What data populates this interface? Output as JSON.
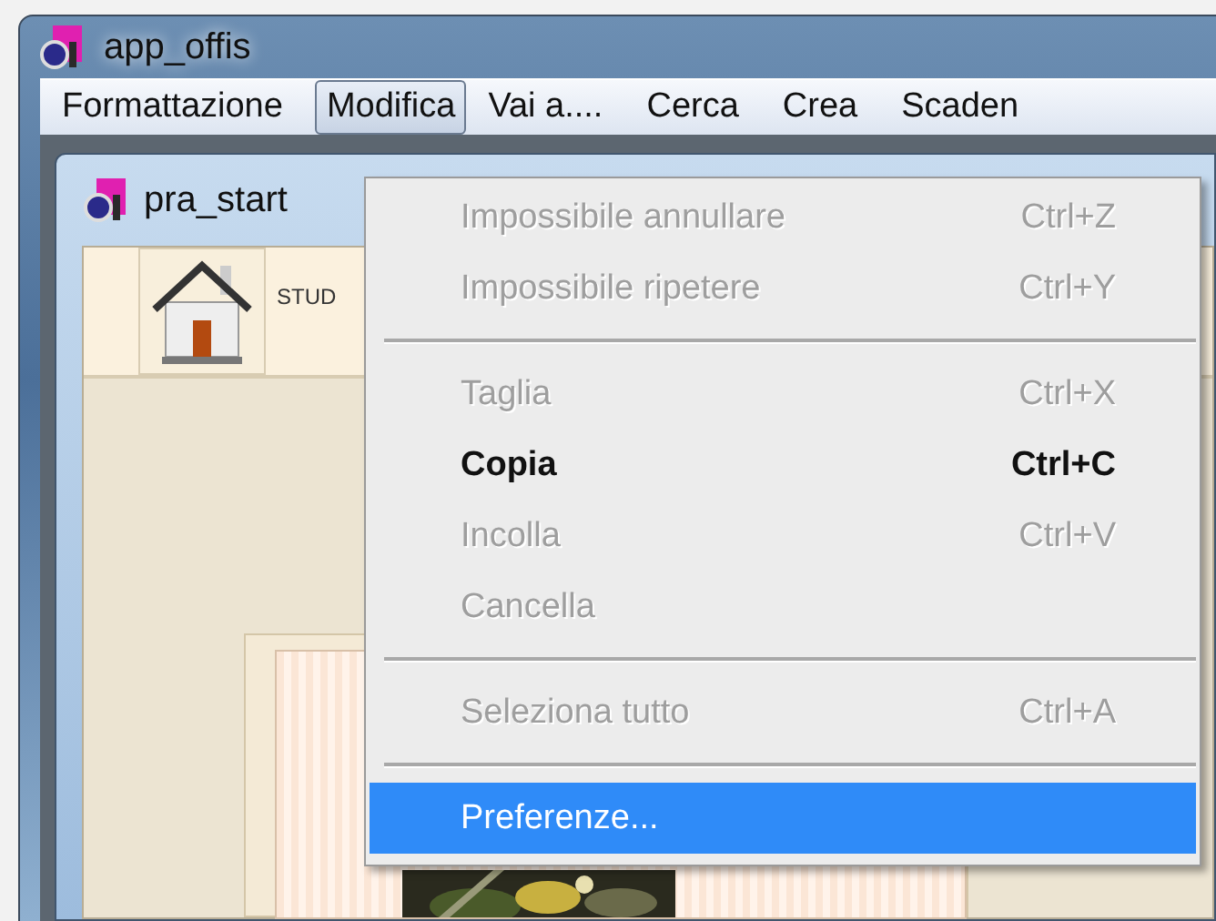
{
  "window": {
    "title": "app_offis"
  },
  "menubar": [
    {
      "label": "Formattazione",
      "selected": false
    },
    {
      "label": "Modifica",
      "selected": true
    },
    {
      "label": "Vai a....",
      "selected": false
    },
    {
      "label": "Cerca",
      "selected": false
    },
    {
      "label": "Crea",
      "selected": false
    },
    {
      "label": "Scaden",
      "selected": false
    }
  ],
  "child_window": {
    "title": "pra_start",
    "toolbar_label": "STUD"
  },
  "menu": [
    {
      "kind": "item",
      "label": "Impossibile annullare",
      "shortcut": "Ctrl+Z",
      "disabled": true,
      "bold": false,
      "selected": false
    },
    {
      "kind": "item",
      "label": "Impossibile ripetere",
      "shortcut": "Ctrl+Y",
      "disabled": true,
      "bold": false,
      "selected": false
    },
    {
      "kind": "separator"
    },
    {
      "kind": "item",
      "label": "Taglia",
      "shortcut": "Ctrl+X",
      "disabled": true,
      "bold": false,
      "selected": false
    },
    {
      "kind": "item",
      "label": "Copia",
      "shortcut": "Ctrl+C",
      "disabled": false,
      "bold": true,
      "selected": false
    },
    {
      "kind": "item",
      "label": "Incolla",
      "shortcut": "Ctrl+V",
      "disabled": true,
      "bold": false,
      "selected": false
    },
    {
      "kind": "item",
      "label": "Cancella",
      "disabled": true,
      "bold": false,
      "selected": false
    },
    {
      "kind": "separator"
    },
    {
      "kind": "item",
      "label": "Seleziona tutto",
      "shortcut": "Ctrl+A",
      "disabled": true,
      "bold": false,
      "selected": false
    },
    {
      "kind": "separator"
    },
    {
      "kind": "item",
      "label": "Preferenze...",
      "disabled": false,
      "bold": false,
      "selected": true
    }
  ]
}
